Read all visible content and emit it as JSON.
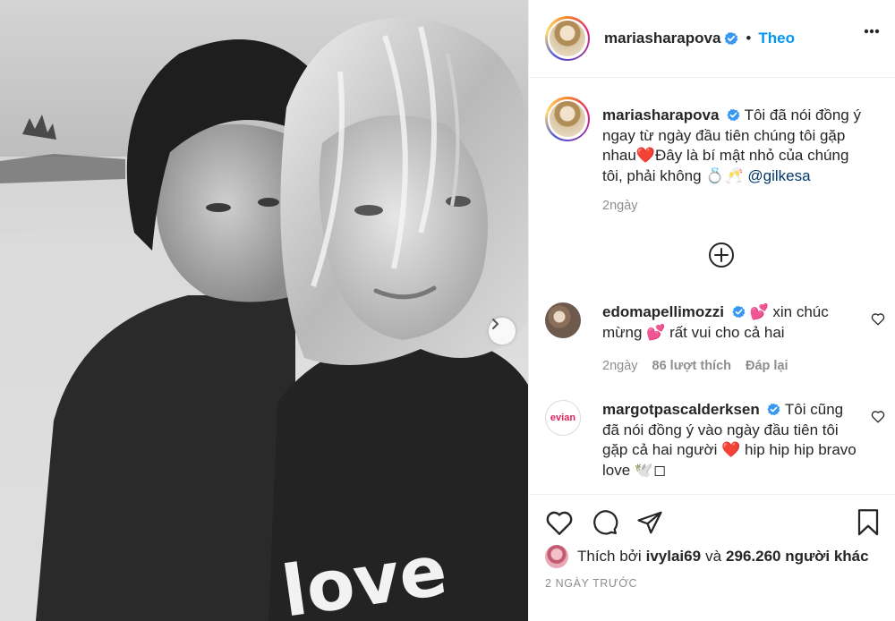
{
  "post": {
    "author": "mariasharapova",
    "follow_label": "Theo",
    "photo_text": "love"
  },
  "caption": {
    "username": "mariasharapova",
    "text": "Tôi đã nói đồng ý ngay từ ngày đầu tiên chúng tôi gặp nhau❤️Đây là bí mật nhỏ của chúng tôi, phải không 💍🥂",
    "mention": "@gilkesa",
    "time": "2ngày"
  },
  "comments": [
    {
      "username": "edomapellimozzi",
      "text": "💕 xin chúc mừng 💕 rất vui cho cả hai",
      "time": "2ngày",
      "likes": "86 lượt thích",
      "reply": "Đáp lại"
    },
    {
      "username": "margotpascalderksen",
      "text": "Tôi cũng đã nói đồng ý vào ngày đầu tiên tôi gặp cả hai người ❤️ hip hip hip bravo love 🕊️◻",
      "avatar_text": "evian"
    }
  ],
  "likes_line": {
    "prefix": "Thích bởi",
    "user": "ivylai69",
    "joiner": "và",
    "others": "296.260 người khác"
  },
  "date": "2 NGÀY TRƯỚC",
  "colors": {
    "accent": "#0095f6",
    "verified": "#3897f0",
    "muted": "#8e8e8e",
    "heart": "#ed4956"
  },
  "icons": [
    "verified-badge-icon",
    "more-icon",
    "chevron-right-icon",
    "plus-circle-icon",
    "heart-icon",
    "comment-icon",
    "share-icon",
    "bookmark-icon"
  ]
}
